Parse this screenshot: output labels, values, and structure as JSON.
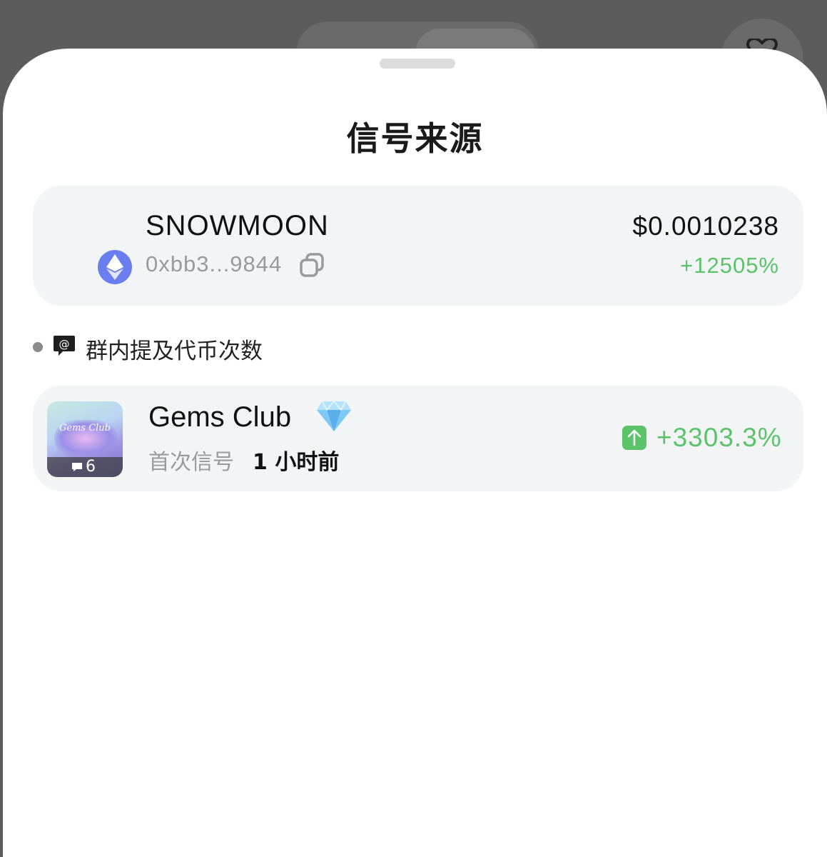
{
  "sheet": {
    "title": "信号来源"
  },
  "token": {
    "name": "SNOWMOON",
    "address": "0xbb3...9844",
    "price": "$0.0010238",
    "change": "+12505%",
    "chain_icon": "ethereum-icon"
  },
  "section": {
    "label": "群内提及代币次数",
    "icon": "mention-chat-icon"
  },
  "group": {
    "name": "Gems Club",
    "badge_icon": "diamond-icon",
    "avatar_text": "Gems Club",
    "mention_count": "6",
    "first_signal_label": "首次信号",
    "first_signal_time": "1 小时前",
    "change": "+3303.3%"
  },
  "colors": {
    "positive": "#5bc46b",
    "card_bg": "#f3f4f6",
    "eth_accent": "#6a7ef0"
  }
}
